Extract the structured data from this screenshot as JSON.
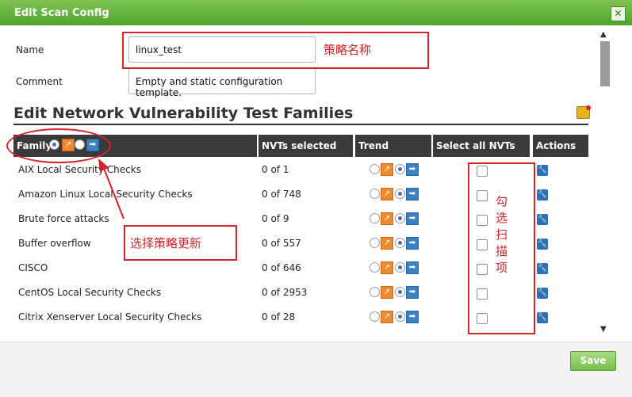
{
  "dialog": {
    "title": "Edit Scan Config",
    "close_label": "✕",
    "save_label": "Save"
  },
  "form": {
    "name_label": "Name",
    "name_value": "linux_test",
    "comment_label": "Comment",
    "comment_value": "Empty and static configuration template."
  },
  "section": {
    "title": "Edit Network Vulnerability Test Families"
  },
  "table": {
    "headers": [
      "Family",
      "NVTs selected",
      "Trend",
      "Select all NVTs",
      "Actions"
    ],
    "rows": [
      {
        "family": "AIX Local Security Checks",
        "nvts": "0 of 1"
      },
      {
        "family": "Amazon Linux Local Security Checks",
        "nvts": "0 of 748"
      },
      {
        "family": "Brute force attacks",
        "nvts": "0 of 9"
      },
      {
        "family": "Buffer overflow",
        "nvts": "0 of 557"
      },
      {
        "family": "CISCO",
        "nvts": "0 of 646"
      },
      {
        "family": "CentOS Local Security Checks",
        "nvts": "0 of 2953"
      },
      {
        "family": "Citrix Xenserver Local Security Checks",
        "nvts": "0 of 28"
      }
    ]
  },
  "annotations": {
    "policy_name": "策略名称",
    "select_policy_update": "选择策略更新",
    "check_scan_items": "勾选扫描项"
  },
  "colors": {
    "title_bar": "#5fb33a",
    "annotation_red": "#d6242a",
    "header_dark": "#3a3a3a"
  }
}
